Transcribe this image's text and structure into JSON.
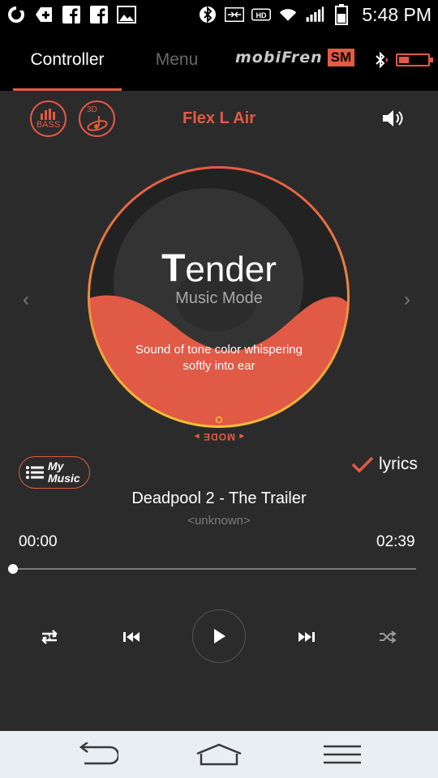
{
  "status_bar": {
    "time": "5:48 PM",
    "icons": [
      "opera-icon",
      "medical-cross-icon",
      "facebook-icon",
      "facebook-icon",
      "gallery-icon",
      "bluetooth-icon",
      "nfc-icon",
      "hd-voice-icon",
      "wifi-icon",
      "signal-icon",
      "battery-icon"
    ]
  },
  "tabs": [
    {
      "label": "Controller",
      "active": true
    },
    {
      "label": "Menu",
      "active": false
    }
  ],
  "brand": {
    "name": "mobiFren",
    "badge": "SM"
  },
  "controls_top": {
    "bass_label": "BASS",
    "three_d_label": "3D",
    "device_name": "Flex L Air"
  },
  "mode": {
    "title_first": "T",
    "title_rest": "ender",
    "subtitle": "Music Mode",
    "description": "Sound of tone color whispering softly into ear",
    "label": "MODE"
  },
  "arrows": {
    "left": "‹",
    "right": "›"
  },
  "music": {
    "my_music_label": "My\nMusic",
    "lyrics_label": "lyrics",
    "song_title": "Deadpool 2 - The Trailer",
    "artist": "<unknown>",
    "time_current": "00:00",
    "time_total": "02:39",
    "progress": 0
  },
  "colors": {
    "accent": "#e45a44",
    "background": "#2b2b2b",
    "ring": "#f0a830"
  }
}
